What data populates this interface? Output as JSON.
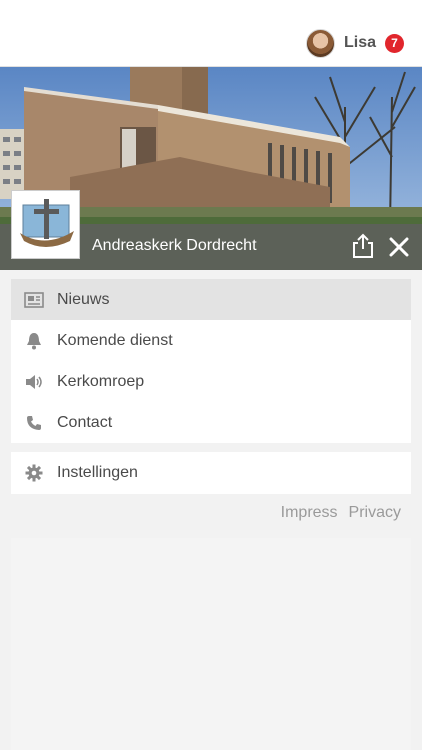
{
  "header": {
    "user_name": "Lisa",
    "notification_count": "7",
    "badge_color": "#e1262c"
  },
  "church": {
    "name": "Andreaskerk Dordrecht"
  },
  "menu": {
    "items": [
      {
        "label": "Nieuws",
        "icon": "newspaper-icon",
        "active": true
      },
      {
        "label": "Komende dienst",
        "icon": "bell-icon"
      },
      {
        "label": "Kerkomroep",
        "icon": "speaker-icon"
      },
      {
        "label": "Contact",
        "icon": "phone-icon"
      }
    ],
    "settings": {
      "label": "Instellingen",
      "icon": "gear-icon"
    }
  },
  "footer": {
    "impress": "Impress",
    "privacy": "Privacy"
  }
}
